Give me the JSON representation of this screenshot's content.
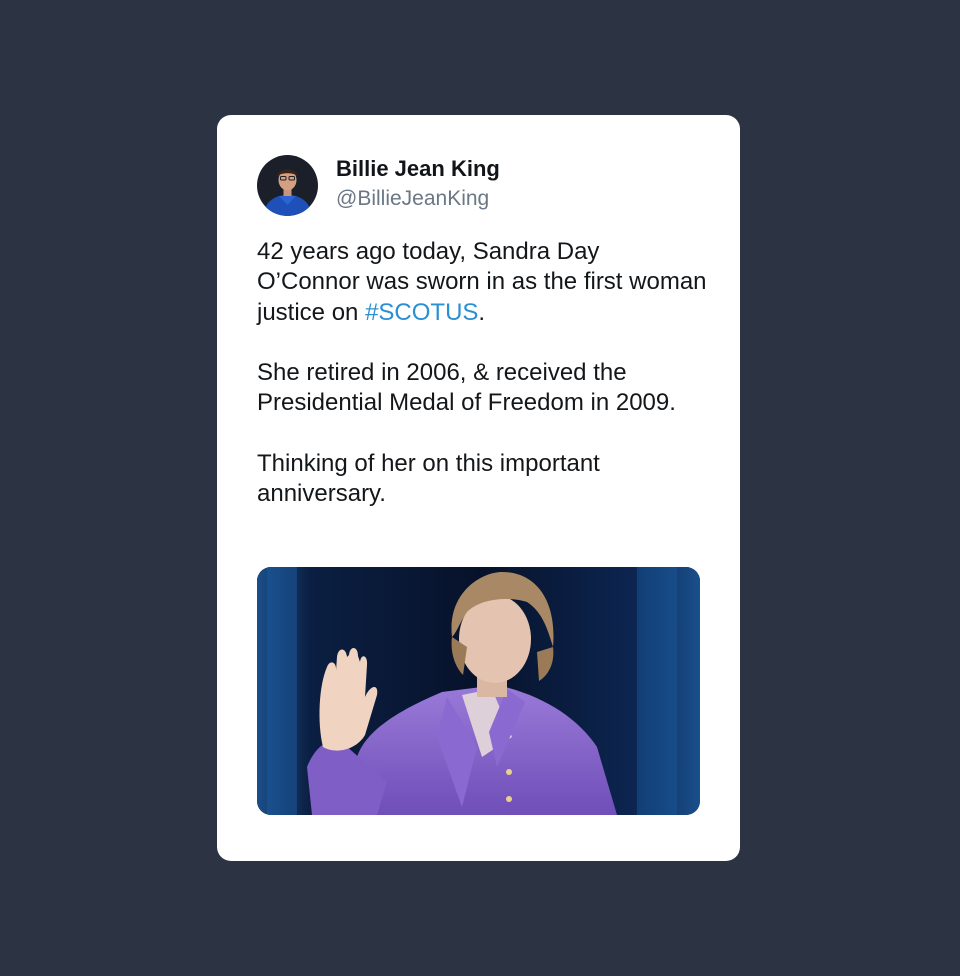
{
  "author": {
    "display_name": "Billie Jean King",
    "handle": "@BillieJeanKing",
    "avatar": "profile-photo"
  },
  "tweet": {
    "paragraph_1_before": "42 years ago today, Sandra Day O’Connor was sworn in as the first woman justice on ",
    "hashtag": "#SCOTUS",
    "paragraph_1_after": ".",
    "paragraph_2": "She retired in 2006, & received the Presidential Medal of Freedom in 2009.",
    "paragraph_3": "Thinking of her on this important anniversary."
  },
  "media": {
    "type": "photo",
    "description_icon": "photo-woman-raising-right-hand"
  },
  "colors": {
    "background": "#2c3444",
    "card": "#ffffff",
    "hashtag": "#2b8fd3",
    "handle": "#6b7785"
  }
}
